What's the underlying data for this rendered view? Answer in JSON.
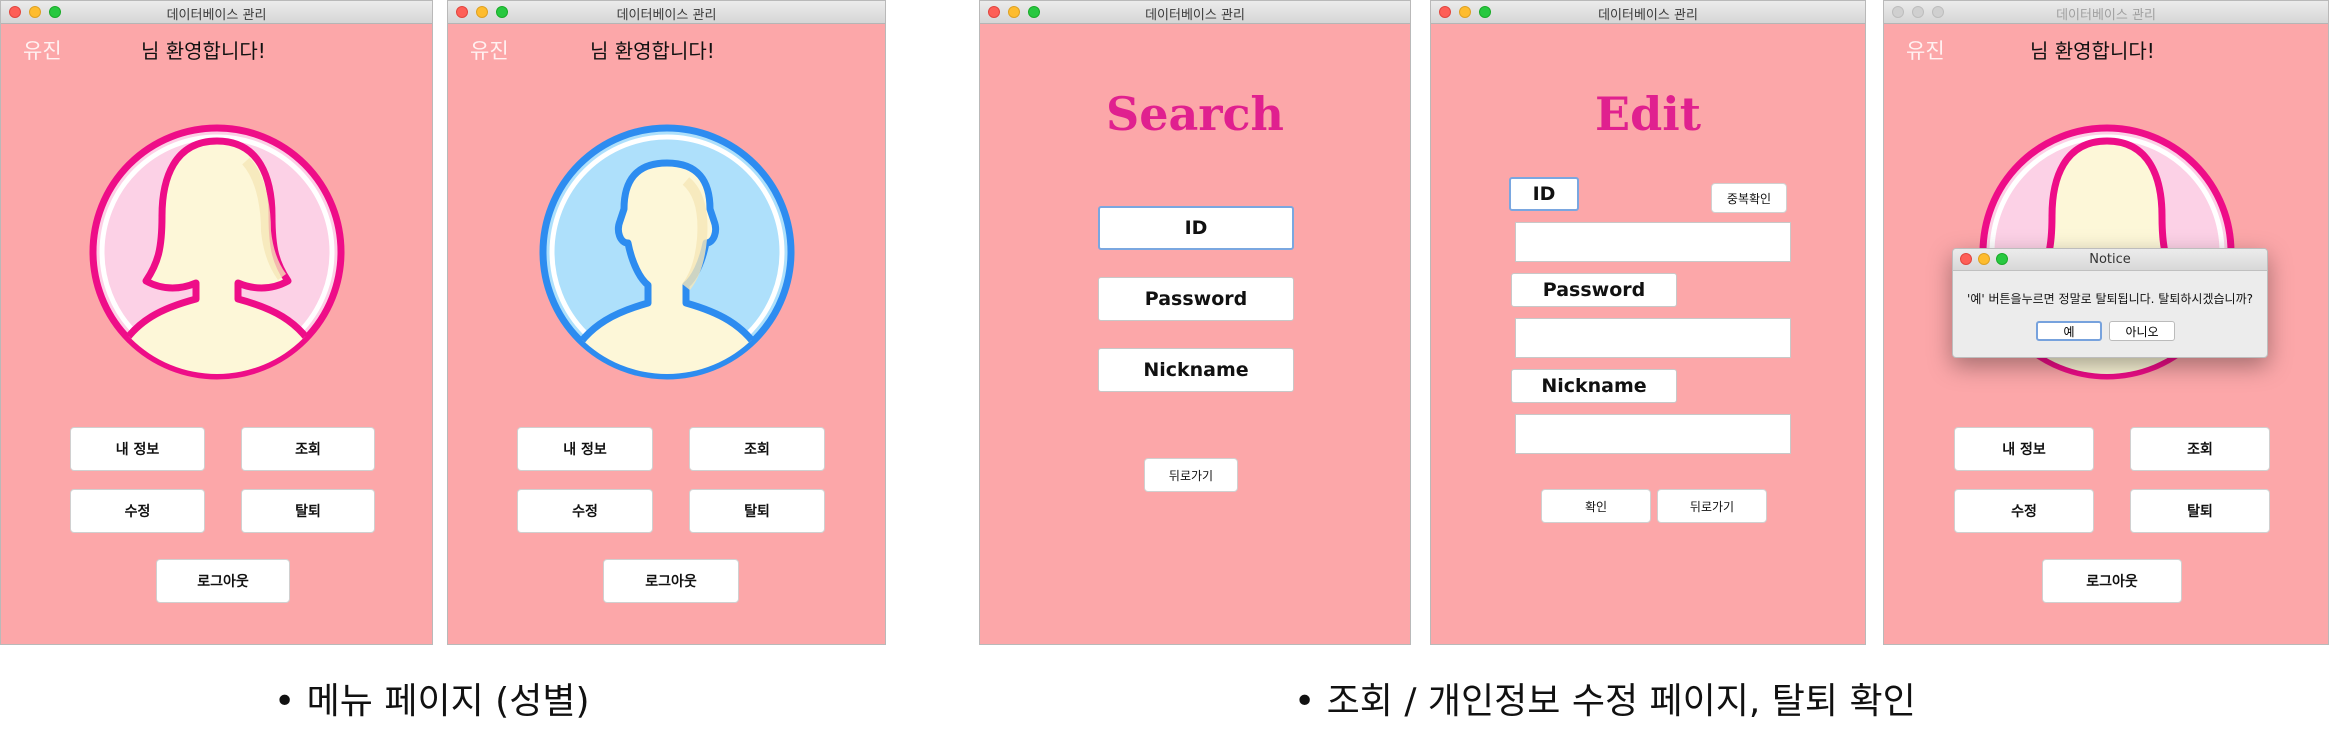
{
  "window_title": "데이터베이스 관리",
  "menu_female": {
    "user_name": "유진",
    "welcome": "님 환영합니다!",
    "buttons": {
      "my_info": "내 정보",
      "search": "조회",
      "edit": "수정",
      "withdraw": "탈퇴",
      "logout": "로그아웃"
    }
  },
  "menu_male": {
    "user_name": "유진",
    "welcome": "님 환영합니다!",
    "buttons": {
      "my_info": "내 정보",
      "search": "조회",
      "edit": "수정",
      "withdraw": "탈퇴",
      "logout": "로그아웃"
    }
  },
  "search_page": {
    "heading": "Search",
    "fields": {
      "id": "ID",
      "password": "Password",
      "nickname": "Nickname"
    },
    "back": "뒤로가기"
  },
  "edit_page": {
    "heading": "Edit",
    "labels": {
      "id": "ID",
      "password": "Password",
      "nickname": "Nickname"
    },
    "dup_check": "중복확인",
    "inputs": {
      "id": "",
      "password": "",
      "nickname": ""
    },
    "confirm": "확인",
    "back": "뒤로가기"
  },
  "withdraw_page": {
    "user_name": "유진",
    "welcome": "님 환영합니다!",
    "buttons": {
      "my_info": "내 정보",
      "search": "조회",
      "edit": "수정",
      "withdraw": "탈퇴",
      "logout": "로그아웃"
    },
    "dialog": {
      "title": "Notice",
      "message": "'예' 버튼을누르면 정말로 탈퇴됩니다. 탈퇴하시겠습니까?",
      "yes": "예",
      "no": "아니오"
    }
  },
  "captions": {
    "left": "• 메뉴 페이지 (성별)",
    "right": "• 조회 / 개인정보 수정 페이지, 탈퇴 확인"
  },
  "colors": {
    "window_bg": "#fca7a9",
    "heading": "#e0208f",
    "female_ring": "#ee0d88",
    "male_ring": "#2d8cf0"
  }
}
